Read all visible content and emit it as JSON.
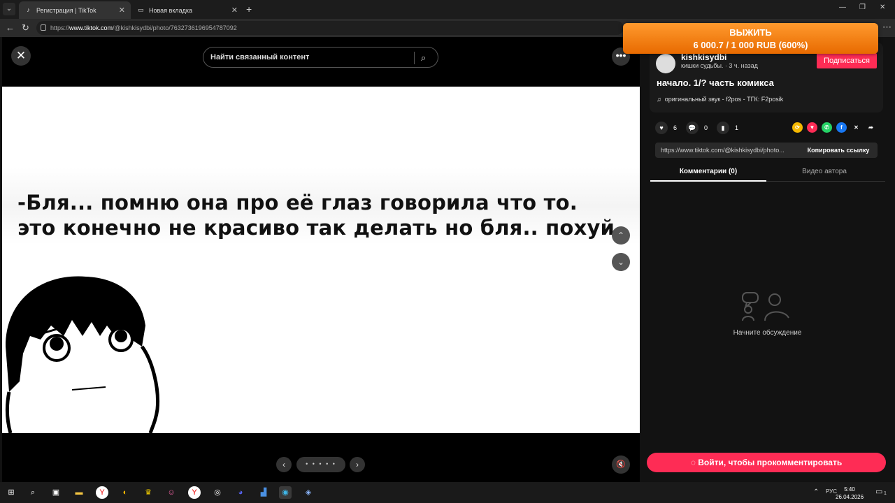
{
  "browser": {
    "tabs": [
      {
        "title": "Регистрация | TikTok",
        "active": true
      },
      {
        "title": "Новая вкладка",
        "active": false
      }
    ],
    "url_prefix": "https://",
    "url_domain": "www.tiktok.com",
    "url_path": "/@kishkisydbi/photo/7632736196954787092"
  },
  "banner": {
    "line1": "ВЫЖИТЬ",
    "line2": "6 000.7 / 1 000 RUB (600%)"
  },
  "viewer": {
    "search_placeholder": "Найти связанный контент",
    "caption_line1": "-Бля... помню она про её глаз говорила что то.",
    "caption_line2": "это конечно не красиво так делать но бля.. похуй",
    "dots": "• • • • •"
  },
  "panel": {
    "username": "kishkisydbi",
    "user_info": "кишки судьбы. · 3 ч. назад",
    "follow_label": "Подписаться",
    "video_title": "начало. 1/? часть комикса",
    "sound": "оригинальный звук - f2pos - ТГК: F2posik",
    "likes": "6",
    "comments": "0",
    "saves": "1",
    "share_url": "https://www.tiktok.com/@kishkisydbi/photo...",
    "copy_label": "Копировать ссылку",
    "tab_comments": "Комментарии (0)",
    "tab_author": "Видео автора",
    "empty_text": "Начните обсуждение",
    "login_label": "Войти, чтобы прокомментировать"
  },
  "taskbar": {
    "lang": "РУС",
    "time": "5:40",
    "date": "26.04.2026",
    "notif_count": "1"
  }
}
